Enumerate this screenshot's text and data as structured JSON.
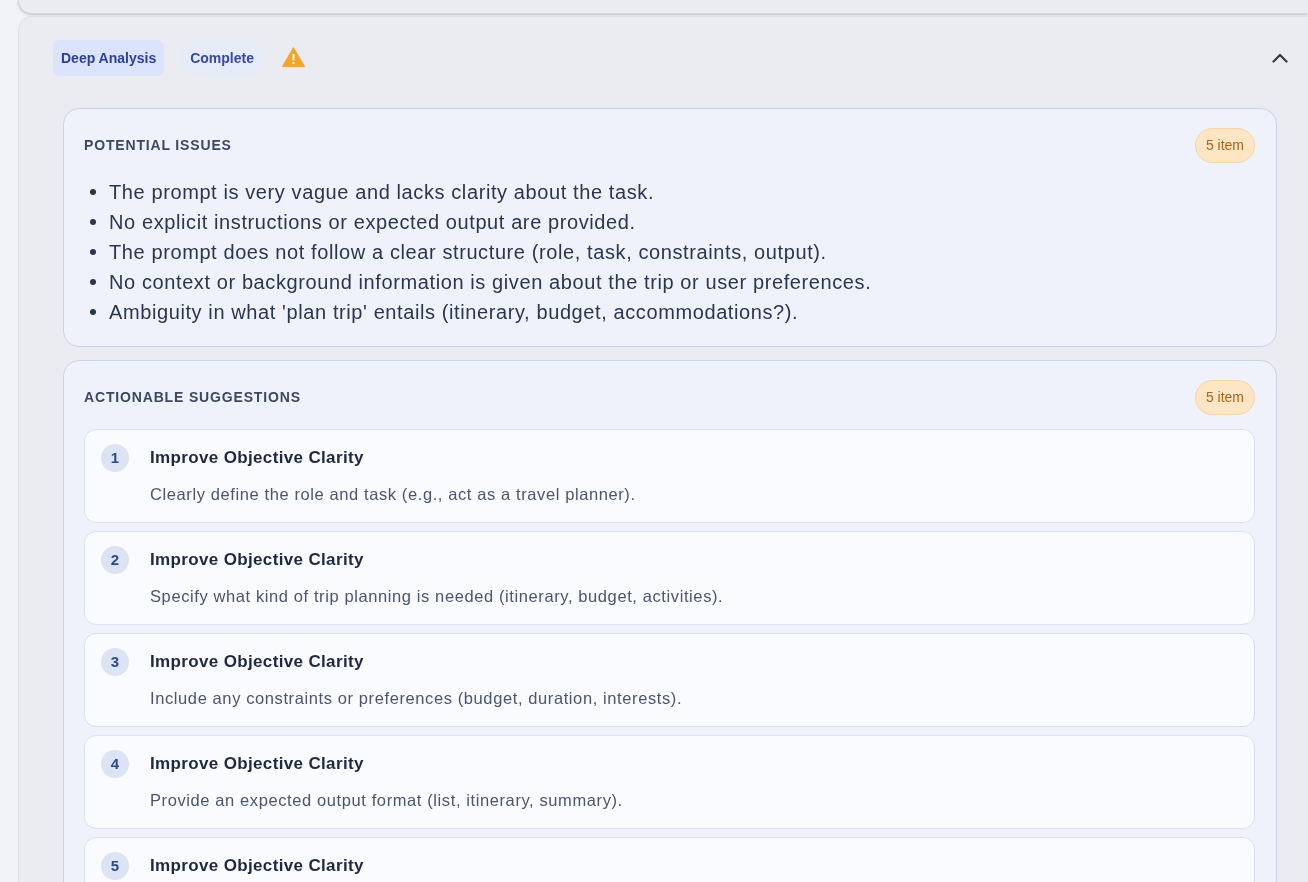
{
  "analysis": {
    "tags": [
      {
        "label": "Deep Analysis",
        "kind": "mode"
      },
      {
        "label": "Complete",
        "kind": "status"
      }
    ],
    "warning": true,
    "expanded": true,
    "sections": [
      {
        "kind": "bullets",
        "title": "POTENTIAL ISSUES",
        "count": "5 item",
        "items": [
          "The prompt is very vague and lacks clarity about the task.",
          "No explicit instructions or expected output are provided.",
          "The prompt does not follow a clear structure (role, task, constraints, output).",
          "No context or background information is given about the trip or user preferences.",
          "Ambiguity in what 'plan trip' entails (itinerary, budget, accommodations?)."
        ]
      },
      {
        "kind": "numbered",
        "title": "ACTIONABLE SUGGESTIONS",
        "count": "5 item",
        "items": [
          {
            "number": "1",
            "title": "Improve Objective Clarity",
            "description": "Clearly define the role and task (e.g., act as a travel planner)."
          },
          {
            "number": "2",
            "title": "Improve Objective Clarity",
            "description": "Specify what kind of trip planning is needed (itinerary, budget, activities)."
          },
          {
            "number": "3",
            "title": "Improve Objective Clarity",
            "description": "Include any constraints or preferences (budget, duration, interests)."
          },
          {
            "number": "4",
            "title": "Improve Objective Clarity",
            "description": "Provide an expected output format (list, itinerary, summary)."
          },
          {
            "number": "5",
            "title": "Improve Objective Clarity"
          }
        ]
      }
    ]
  }
}
